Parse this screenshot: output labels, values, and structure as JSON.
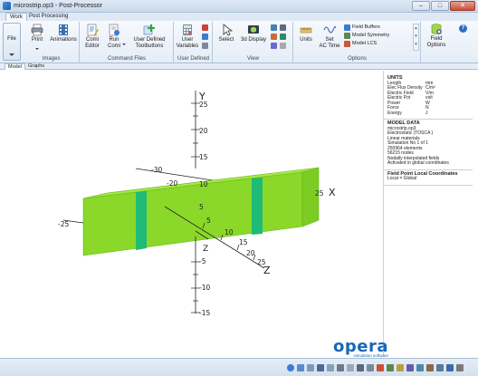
{
  "window": {
    "title": "microstrip.op3 - Post-Processor"
  },
  "ribbon_tabs": [
    {
      "label": "Work",
      "active": true
    },
    {
      "label": "Post Processing",
      "active": false
    }
  ],
  "ribbon": {
    "file_label": "File",
    "groups": [
      {
        "label": "Images",
        "buttons": [
          "Print",
          "Animations"
        ]
      },
      {
        "label": "Command Files",
        "buttons": [
          "Comi\nEditor",
          "Run\nComi",
          "User Defined\nToolbuttons"
        ]
      },
      {
        "label": "User Defined",
        "buttons": [
          "User\nVariables"
        ]
      },
      {
        "label": "View",
        "buttons": [
          "Select",
          "3d Display"
        ]
      },
      {
        "label": "Options",
        "buttons": [
          "Units",
          "Set\nAC Time"
        ],
        "small_buttons": [
          "Field Buffers",
          "Model Symmetry",
          "Model LCS"
        ]
      },
      {
        "label": "",
        "buttons": [
          "Field\nOptions"
        ]
      }
    ]
  },
  "view_tabs": [
    {
      "label": "Model",
      "active": true
    },
    {
      "label": "Graphs",
      "active": false
    }
  ],
  "axes": {
    "y_label": "Y",
    "x_label": "X",
    "z_label": "Z",
    "y_ticks": [
      "25",
      "20",
      "15",
      "10",
      "5",
      "-5",
      "-10",
      "-15"
    ],
    "x_ticks": [
      "-30",
      "-25",
      "-20",
      "25"
    ],
    "z_ticks": [
      "5",
      "10",
      "15",
      "20",
      "25"
    ]
  },
  "info_panel": {
    "units_heading": "UNITS",
    "units": [
      {
        "key": "Length",
        "value": "mm"
      },
      {
        "key": "Elec Flux Density",
        "value": "C/m²"
      },
      {
        "key": "Electric Field",
        "value": "V/m"
      },
      {
        "key": "Electric Pot",
        "value": "volt"
      },
      {
        "key": "Power",
        "value": "W"
      },
      {
        "key": "Force",
        "value": "N"
      },
      {
        "key": "Energy",
        "value": "J"
      }
    ],
    "model_heading": "MODEL DATA",
    "model_lines": [
      "microstrip.op3",
      "Electrostatic (TOSCA )",
      "Linear materials",
      "Simulation No 1 of 1",
      "250964 elements",
      "56215 nodes",
      "Nodally interpolated fields",
      "Activated in global coordinates"
    ],
    "fp_heading": "Field Point Local Coordinates",
    "fp_line": "Local = Global"
  },
  "logo": {
    "name": "opera",
    "tagline": "simulation software"
  },
  "colors": {
    "model_green": "#8fdc2c",
    "strip_teal": "#1fb873",
    "accent_blue": "#1868b8"
  }
}
